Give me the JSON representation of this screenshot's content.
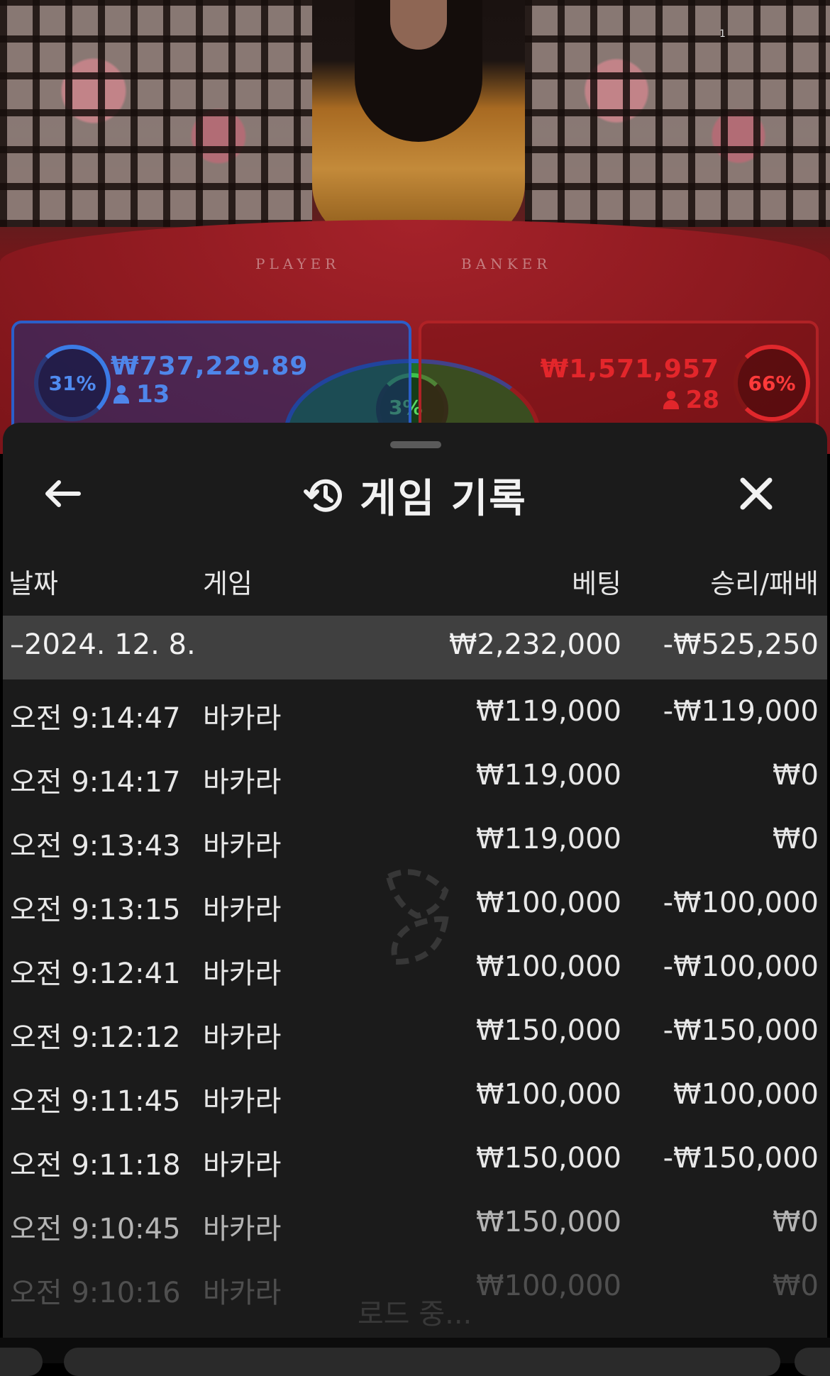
{
  "video": {
    "corner_tag": "1",
    "felt_player": "PLAYER",
    "felt_banker": "BANKER"
  },
  "bets": {
    "player": {
      "percent": "31%",
      "amount": "₩737,229.89",
      "count": "13"
    },
    "tie": {
      "percent": "3%"
    },
    "banker": {
      "percent": "66%",
      "amount": "₩1,571,957",
      "count": "28"
    }
  },
  "sheet": {
    "title": "게임 기록",
    "columns": {
      "date": "날짜",
      "game": "게임",
      "bet": "베팅",
      "win_loss": "승리/패배"
    },
    "day": {
      "date": "–2024. 12. 8.",
      "bet": "₩2,232,000",
      "win_loss": "-₩525,250"
    },
    "rows": [
      {
        "time": "오전 9:14:47",
        "game": "바카라",
        "bet": "₩119,000",
        "win_loss": "-₩119,000"
      },
      {
        "time": "오전 9:14:17",
        "game": "바카라",
        "bet": "₩119,000",
        "win_loss": "₩0"
      },
      {
        "time": "오전 9:13:43",
        "game": "바카라",
        "bet": "₩119,000",
        "win_loss": "₩0"
      },
      {
        "time": "오전 9:13:15",
        "game": "바카라",
        "bet": "₩100,000",
        "win_loss": "-₩100,000"
      },
      {
        "time": "오전 9:12:41",
        "game": "바카라",
        "bet": "₩100,000",
        "win_loss": "-₩100,000"
      },
      {
        "time": "오전 9:12:12",
        "game": "바카라",
        "bet": "₩150,000",
        "win_loss": "-₩150,000"
      },
      {
        "time": "오전 9:11:45",
        "game": "바카라",
        "bet": "₩100,000",
        "win_loss": "₩100,000"
      },
      {
        "time": "오전 9:11:18",
        "game": "바카라",
        "bet": "₩150,000",
        "win_loss": "-₩150,000"
      },
      {
        "time": "오전 9:10:45",
        "game": "바카라",
        "bet": "₩150,000",
        "win_loss": "₩0"
      },
      {
        "time": "오전 9:10:16",
        "game": "바카라",
        "bet": "₩100,000",
        "win_loss": "₩0"
      }
    ],
    "loading_text": "로드 중..."
  },
  "icons": {
    "back": "arrow-left-icon",
    "history": "history-clock-icon",
    "close": "close-icon"
  },
  "colors": {
    "player": "#2b5ec9",
    "banker": "#b02226",
    "tie": "#3ec24a",
    "sheet_bg": "#1b1b1b",
    "day_row_bg": "#404040"
  }
}
